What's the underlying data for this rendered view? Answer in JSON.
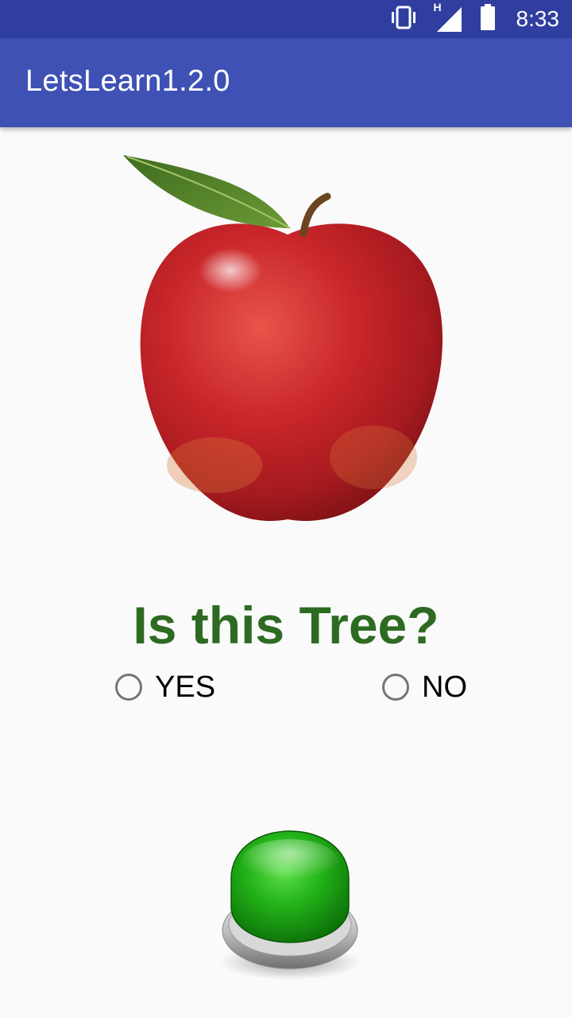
{
  "status_bar": {
    "time": "8:33",
    "network_type": "H",
    "icons": [
      "vibrate-icon",
      "signal-icon",
      "battery-icon"
    ]
  },
  "app_bar": {
    "title": "LetsLearn1.2.0"
  },
  "content": {
    "image": "apple-image",
    "question": "Is this Tree?",
    "options": [
      {
        "label": "YES",
        "selected": false
      },
      {
        "label": "NO",
        "selected": false
      }
    ],
    "submit_button": "green-button-icon"
  },
  "colors": {
    "status_bar": "#303f9f",
    "app_bar": "#3f51b5",
    "question_text": "#2e6b22",
    "background": "#fafafa",
    "radio_border": "#757575"
  }
}
